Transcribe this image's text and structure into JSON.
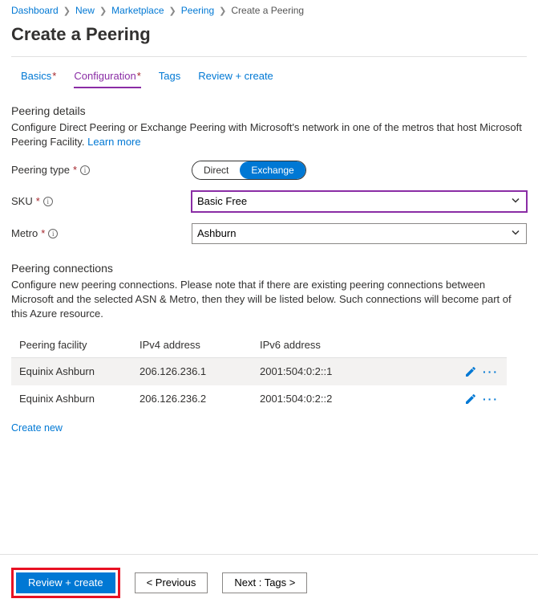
{
  "breadcrumb": {
    "items": [
      {
        "label": "Dashboard"
      },
      {
        "label": "New"
      },
      {
        "label": "Marketplace"
      },
      {
        "label": "Peering"
      }
    ],
    "current": "Create a Peering"
  },
  "page_title": "Create a Peering",
  "tabs": {
    "basics": "Basics",
    "configuration": "Configuration",
    "tags": "Tags",
    "review": "Review + create"
  },
  "details": {
    "title": "Peering details",
    "desc": "Configure Direct Peering or Exchange Peering with Microsoft's network in one of the metros that host Microsoft Peering Facility. ",
    "learn_more": "Learn more"
  },
  "form": {
    "peering_type_label": "Peering type",
    "peering_type_options": {
      "direct": "Direct",
      "exchange": "Exchange"
    },
    "sku_label": "SKU",
    "sku_value": "Basic Free",
    "metro_label": "Metro",
    "metro_value": "Ashburn"
  },
  "connections": {
    "title": "Peering connections",
    "desc": "Configure new peering connections. Please note that if there are existing peering connections between Microsoft and the selected ASN & Metro, then they will be listed below. Such connections will become part of this Azure resource.",
    "headers": {
      "facility": "Peering facility",
      "ipv4": "IPv4 address",
      "ipv6": "IPv6 address"
    },
    "rows": [
      {
        "facility": "Equinix Ashburn",
        "ipv4": "206.126.236.1",
        "ipv6": "2001:504:0:2::1"
      },
      {
        "facility": "Equinix Ashburn",
        "ipv4": "206.126.236.2",
        "ipv6": "2001:504:0:2::2"
      }
    ],
    "create_new": "Create new"
  },
  "footer": {
    "review": "Review + create",
    "previous": "< Previous",
    "next": "Next : Tags >"
  }
}
